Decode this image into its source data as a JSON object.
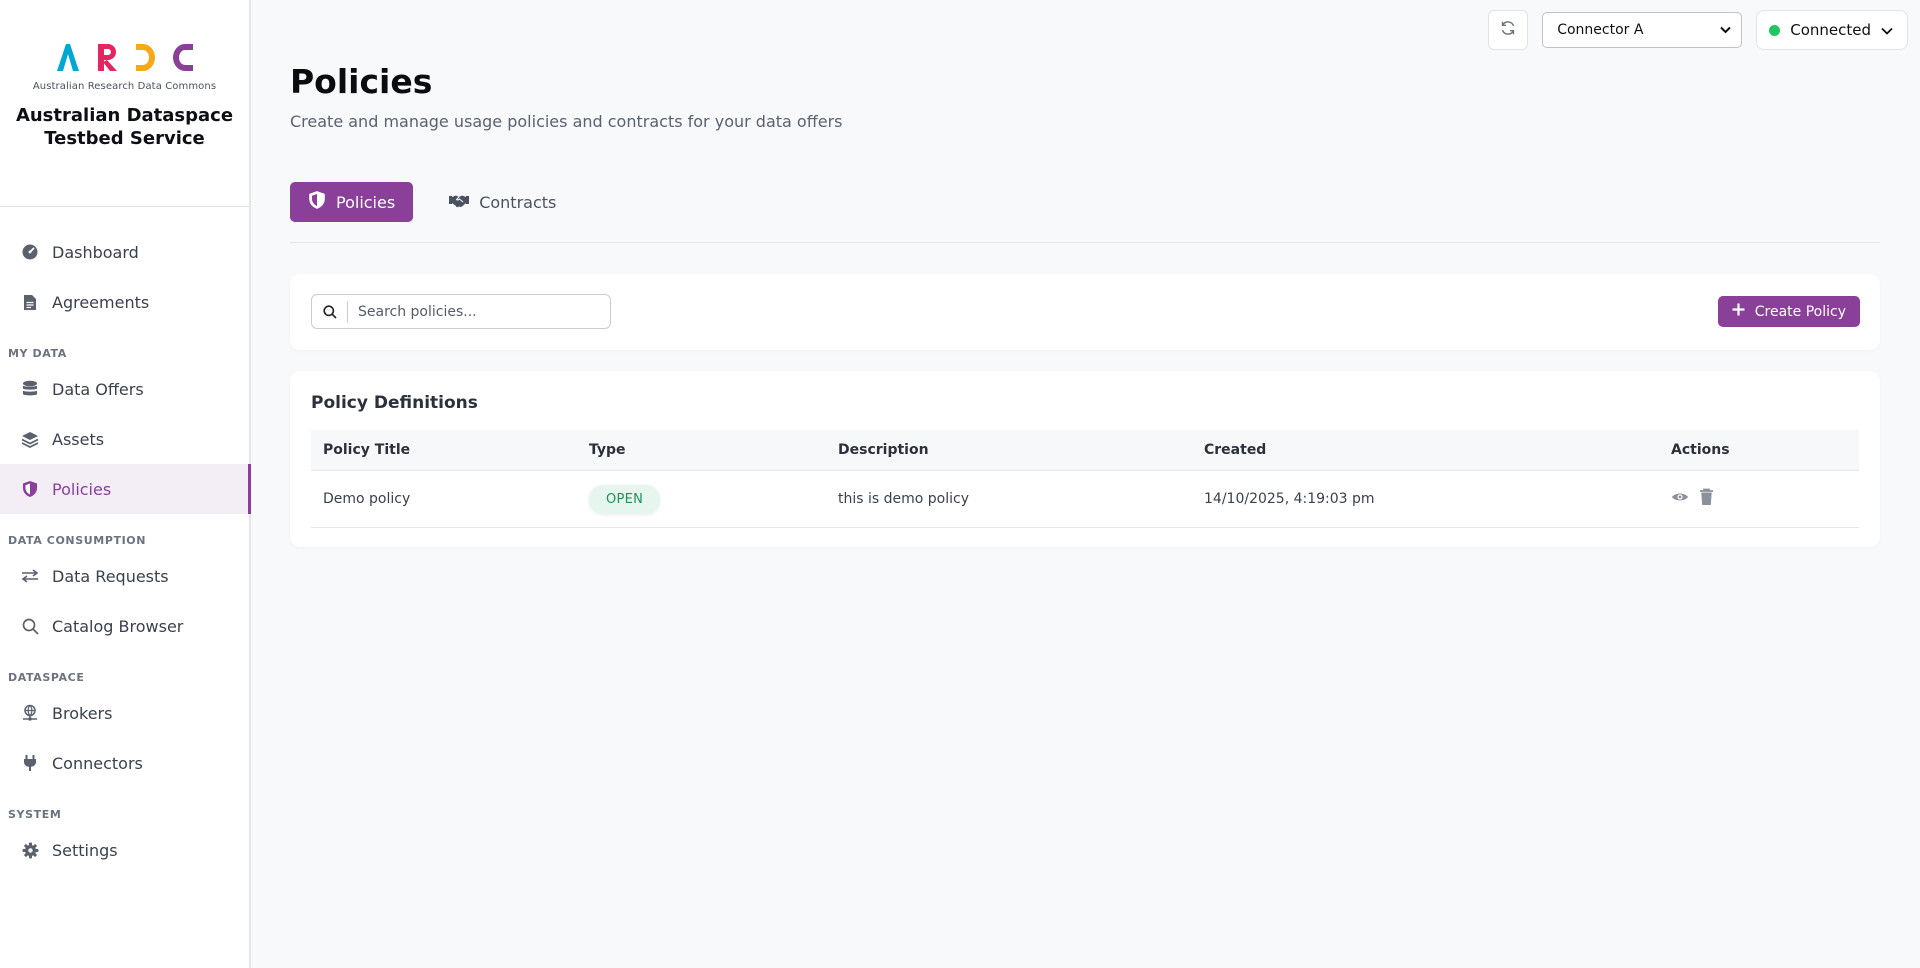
{
  "brand": {
    "logo_letters": [
      "A",
      "R",
      "D",
      "C"
    ],
    "logo_colors": [
      "#00a7d3",
      "#e6245f",
      "#f5a916",
      "#8a3f98"
    ],
    "logo_subtitle": "Australian Research Data Commons",
    "title": "Australian Dataspace Testbed Service"
  },
  "sidebar": {
    "items_top": [
      {
        "label": "Dashboard",
        "icon": "gauge-icon"
      },
      {
        "label": "Agreements",
        "icon": "document-icon"
      }
    ],
    "section_my_data": "MY DATA",
    "items_my_data": [
      {
        "label": "Data Offers",
        "icon": "database-icon"
      },
      {
        "label": "Assets",
        "icon": "layers-icon"
      },
      {
        "label": "Policies",
        "icon": "shield-icon",
        "active": true
      }
    ],
    "section_consumption": "DATA CONSUMPTION",
    "items_consumption": [
      {
        "label": "Data Requests",
        "icon": "arrows-exchange-icon"
      },
      {
        "label": "Catalog Browser",
        "icon": "search-icon"
      }
    ],
    "section_dataspace": "DATASPACE",
    "items_dataspace": [
      {
        "label": "Brokers",
        "icon": "globe-network-icon"
      },
      {
        "label": "Connectors",
        "icon": "plug-icon"
      }
    ],
    "section_system": "SYSTEM",
    "items_system": [
      {
        "label": "Settings",
        "icon": "gear-icon"
      }
    ]
  },
  "topbar": {
    "connector_selected": "Connector A",
    "status_label": "Connected",
    "status_color": "#22c55e"
  },
  "page": {
    "title": "Policies",
    "subtitle": "Create and manage usage policies and contracts for your data offers"
  },
  "tabs": [
    {
      "label": "Policies",
      "icon": "shield-icon",
      "active": true
    },
    {
      "label": "Contracts",
      "icon": "handshake-icon",
      "active": false
    }
  ],
  "search": {
    "placeholder": "Search policies..."
  },
  "create_button": {
    "label": "Create Policy"
  },
  "table": {
    "title": "Policy Definitions",
    "columns": [
      "Policy Title",
      "Type",
      "Description",
      "Created",
      "Actions"
    ],
    "rows": [
      {
        "title": "Demo policy",
        "type": "OPEN",
        "description": "this is demo policy",
        "created": "14/10/2025, 4:19:03 pm"
      }
    ]
  },
  "accent_color": "#8a3f98"
}
